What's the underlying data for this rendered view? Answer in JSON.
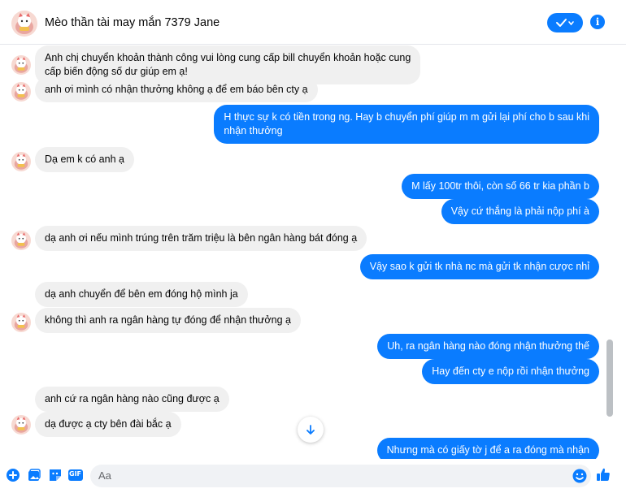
{
  "header": {
    "title": "Mèo thần tài may mắn 7379 Jane",
    "accent": "#0a7cff"
  },
  "messages": [
    {
      "dir": "in",
      "lines": [
        "Anh chị chuyển khoản thành công vui lòng cung cấp bill chuyển khoản hoặc cung",
        "cấp biến động số dư giúp em ạ!"
      ]
    },
    {
      "dir": "in",
      "lines": [
        "anh ơi mình có nhận thưởng không ạ để em báo bên cty ạ"
      ]
    },
    {
      "dir": "out",
      "lines": [
        "H thực sự k có tiền trong ng. Hay b chuyển phí giúp m m gửi lại phí cho b sau khi",
        "nhận thưởng"
      ]
    },
    {
      "dir": "in",
      "lines": [
        "Dạ em k có anh ạ"
      ]
    },
    {
      "dir": "out",
      "lines": [
        "M lấy 100tr thôi, còn số 66 tr kia phần b"
      ]
    },
    {
      "dir": "out",
      "lines": [
        "Vậy cứ thắng là phải nộp phí à"
      ]
    },
    {
      "dir": "in",
      "lines": [
        "dạ anh ơi nếu mình trúng trên trăm triệu là bên ngân hàng bát đóng ạ"
      ]
    },
    {
      "dir": "out",
      "lines": [
        "Vậy sao k gửi tk nhà nc mà gửi tk nhận cược nhỉ"
      ]
    },
    {
      "dir": "in",
      "lines": [
        "dạ anh chuyển để bên em đóng hộ mình ja"
      ]
    },
    {
      "dir": "in",
      "lines": [
        "không thì anh ra ngân hàng tự đóng để nhận thưởng ạ"
      ]
    },
    {
      "dir": "out",
      "lines": [
        "Uh, ra ngân hàng nào đóng nhận thưởng thế"
      ]
    },
    {
      "dir": "out",
      "lines": [
        "Hay đến cty e nộp rồi nhận thưởng"
      ]
    },
    {
      "dir": "in",
      "lines": [
        "anh cứ ra ngân hàng nào cũng được ạ"
      ]
    },
    {
      "dir": "in",
      "lines": [
        "dạ được ạ cty bên đài bắc ạ"
      ]
    },
    {
      "dir": "out",
      "lines": [
        "Nhưng mà có giấy tờ j để a ra đóng mà nhận"
      ]
    }
  ],
  "composer": {
    "placeholder": "Aa",
    "icons": [
      "plus-icon",
      "image-icon",
      "sticker-icon",
      "gif-icon",
      "emoji-icon",
      "like-icon"
    ],
    "gif_label": "GIF"
  }
}
